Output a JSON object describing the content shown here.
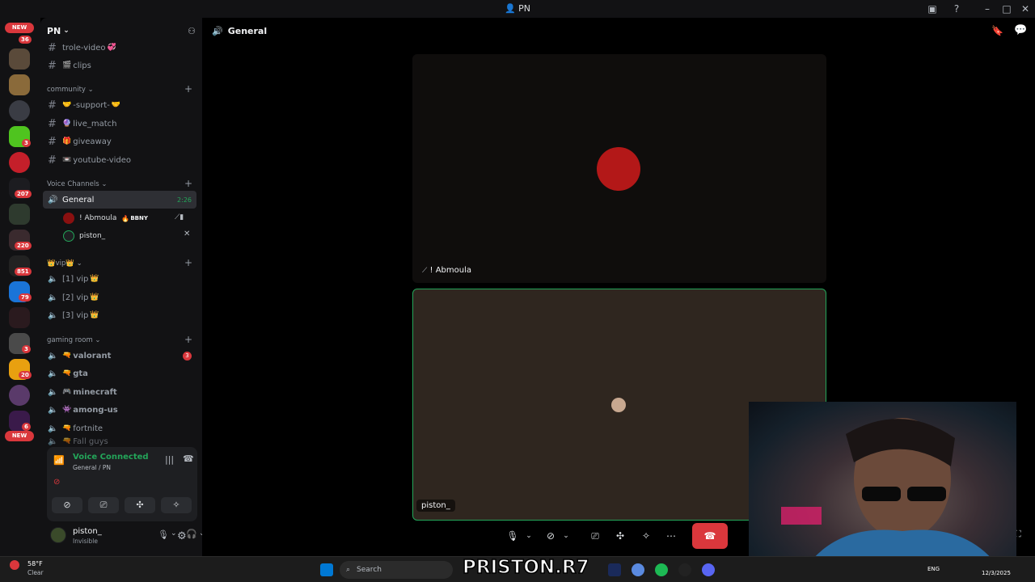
{
  "window": {
    "title": "PN"
  },
  "server": {
    "name": "PN"
  },
  "rail_badges": [
    "NEW",
    "36",
    "3",
    "207",
    "220",
    "851",
    "79",
    "3",
    "20",
    "6",
    "NEW"
  ],
  "channels_top": [
    {
      "name": "trole-video",
      "emoji": "💞"
    },
    {
      "name": "clips",
      "emoji": "🎬"
    }
  ],
  "community": {
    "label": "community",
    "channels": [
      {
        "name": "-support-",
        "emoji": "🤝",
        "emoji_after": "🤝"
      },
      {
        "name": "live_match",
        "emoji": "🔮"
      },
      {
        "name": "giveaway",
        "emoji": "🎁"
      },
      {
        "name": "youtube-video",
        "emoji": "📼"
      }
    ]
  },
  "voice_channels": {
    "label": "Voice Channels",
    "general": {
      "name": "General",
      "time": "2:26"
    },
    "users": [
      {
        "name": "! Abmoula",
        "tag": "BBNY",
        "tag_emoji": "🔥"
      },
      {
        "name": "piston_"
      }
    ]
  },
  "vip": {
    "label": "vip",
    "channels": [
      {
        "name": "[1] vip",
        "emoji": "👑"
      },
      {
        "name": "[2] vip",
        "emoji": "👑"
      },
      {
        "name": "[3] vip",
        "emoji": "👑"
      }
    ]
  },
  "gaming": {
    "label": "gaming room",
    "channels": [
      {
        "name": "valorant",
        "emoji": "🔫",
        "badge": "3"
      },
      {
        "name": "gta",
        "emoji": "🔫"
      },
      {
        "name": "minecraft",
        "emoji": "🎮"
      },
      {
        "name": "among-us",
        "emoji": "👾"
      },
      {
        "name": "fortnite",
        "emoji": "🔫"
      },
      {
        "name": "Fall guys",
        "emoji": "🔫"
      }
    ]
  },
  "voice_status": {
    "title": "Voice Connected",
    "subtitle": "General / PN"
  },
  "current_user": {
    "name": "piston_",
    "status": "Invisible"
  },
  "main": {
    "channel": "General",
    "tiles": [
      {
        "label": "! Abmoula"
      },
      {
        "label": "piston_"
      }
    ]
  },
  "taskbar": {
    "weather_temp": "58°F",
    "weather_desc": "Clear",
    "search_placeholder": "Search",
    "language": "ENG",
    "date": "12/3/2025",
    "watermark": "PRISTON.R7"
  },
  "colors": {
    "accent_green": "#23a559",
    "danger_red": "#da373c",
    "bg": "#121214"
  }
}
